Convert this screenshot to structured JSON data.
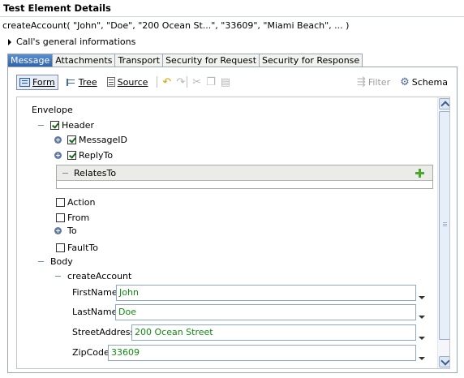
{
  "header": {
    "title": "Test Element Details",
    "call_signature": "createAccount( \"John\", \"Doe\", \"200 Ocean St...\", \"33609\", \"Miami Beach\", ... )",
    "general_info": "Call's general informations"
  },
  "tabs": [
    "Message",
    "Attachments",
    "Transport",
    "Security for Request",
    "Security for Response"
  ],
  "toolbar": {
    "form": "Form",
    "tree": "Tree",
    "source": "Source",
    "filter": "Filter",
    "schema": "Schema"
  },
  "tree": {
    "envelope": "Envelope",
    "header": "Header",
    "message_id": "MessageID",
    "reply_to": "ReplyTo",
    "relates_to": "RelatesTo",
    "action": "Action",
    "from": "From",
    "to": "To",
    "fault_to": "FaultTo",
    "body": "Body",
    "create_account": "createAccount"
  },
  "fields": {
    "first_name": {
      "label": "FirstName",
      "value": "John"
    },
    "last_name": {
      "label": "LastName",
      "value": "Doe"
    },
    "street": {
      "label": "StreetAddress",
      "value": "200 Ocean Street"
    },
    "zip": {
      "label": "ZipCode",
      "value": "33609"
    }
  },
  "colors": {
    "accent": "#2f64a8",
    "value_text": "#118a11"
  }
}
